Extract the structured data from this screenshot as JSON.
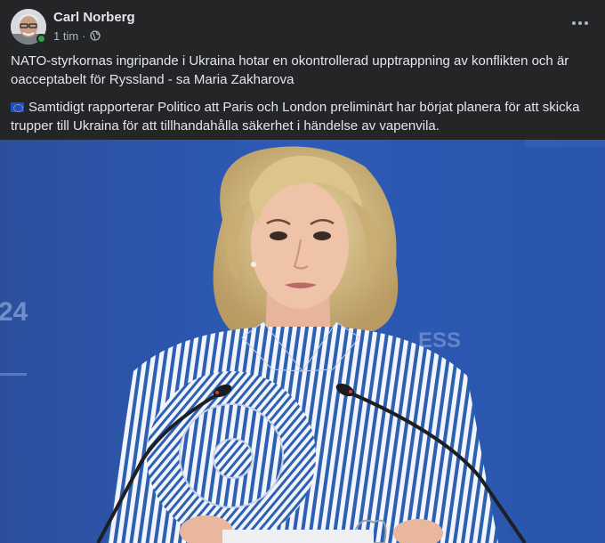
{
  "post": {
    "author_name": "Carl Norberg",
    "timestamp": "1 tim",
    "separator": "·",
    "privacy_icon": "globe-icon",
    "more_icon": "more-options-icon",
    "paragraphs": [
      "NATO-styrkornas ingripande i Ukraina hotar en okontrollerad upptrappning av konflikten och är oacceptabelt för Ryssland - sa Maria Zakharova",
      "Samtidigt rapporterar Politico att Paris och London preliminärt har börjat planera för att skicka trupper till Ukraina för att tillhandahålla säkerhet i händelse av vapenvila."
    ],
    "paragraph2_icon": "eu-flag-icon"
  },
  "photo": {
    "backdrop_text_left": "24",
    "backdrop_text_right": "ESS"
  },
  "colors": {
    "background": "#242526",
    "text_primary": "#e4e6eb",
    "text_secondary": "#b0b3b8",
    "online": "#31a24c",
    "photo_backdrop": "#2a54ad"
  }
}
